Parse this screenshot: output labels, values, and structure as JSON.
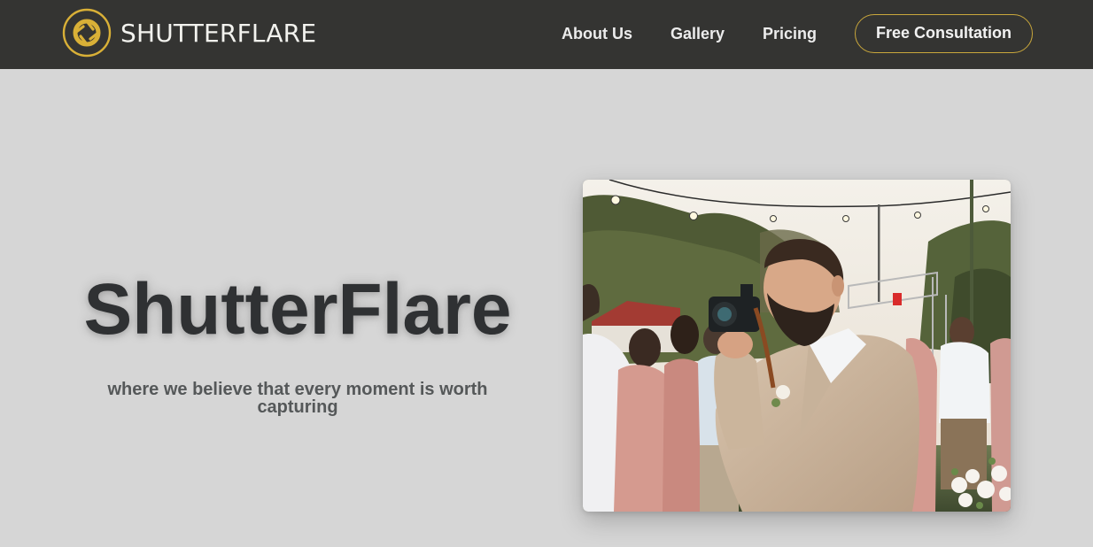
{
  "nav": {
    "brand": "SHUTTERFLARE",
    "logo_icon": "aperture-icon",
    "links": [
      "About Us",
      "Gallery",
      "Pricing"
    ],
    "cta_label": "Free Consultation"
  },
  "hero": {
    "title": "ShutterFlare",
    "subtitle": "where we believe that every moment is worth capturing",
    "photo_subject": "photographer-at-wedding"
  },
  "colors": {
    "nav_background": "#343432",
    "accent_gold": "#c9a73c",
    "page_background": "#d6d6d6",
    "title_text": "#2f3133",
    "subtitle_text": "#555859"
  }
}
